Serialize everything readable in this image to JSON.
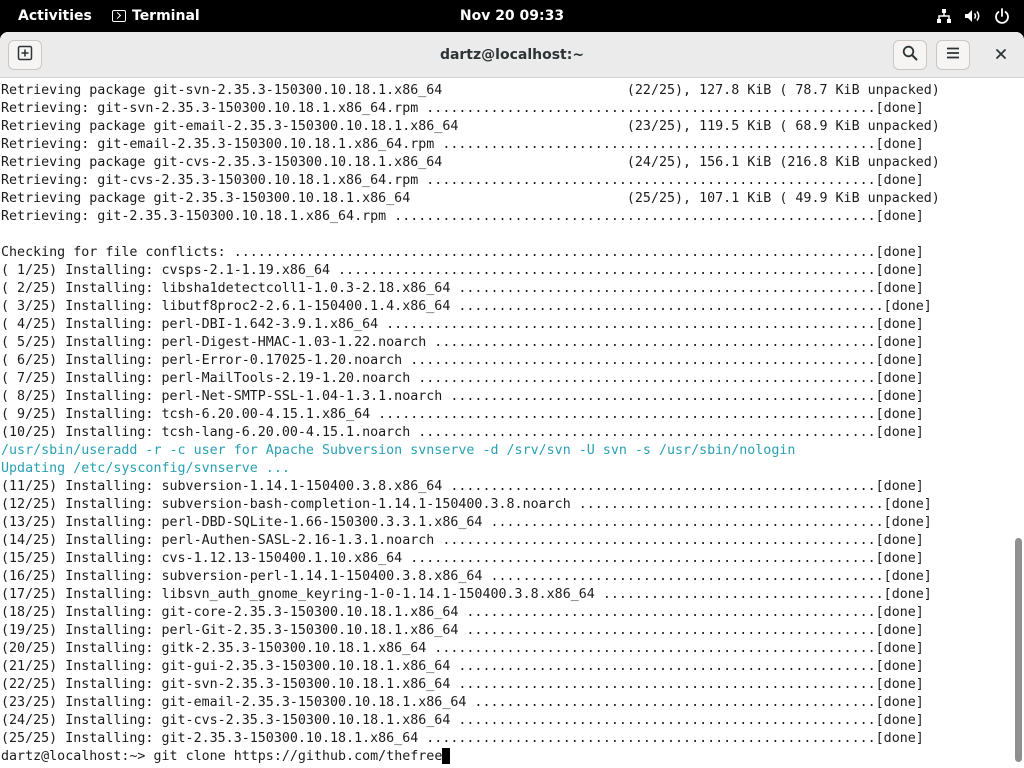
{
  "topbar": {
    "activities": "Activities",
    "app_name": "Terminal",
    "clock": "Nov 20  09:33",
    "icons": [
      "network-icon",
      "volume-icon",
      "power-icon"
    ]
  },
  "window": {
    "title": "dartz@localhost:~",
    "buttons": [
      "new-tab-icon",
      "search-icon",
      "hamburger-menu-icon",
      "close-icon"
    ]
  },
  "colors": {
    "terminal_text": "#1c1c1c",
    "cyan_text": "#2aa1b3",
    "terminal_bg": "#ffffff",
    "topbar_bg": "#000000"
  },
  "terminal": {
    "lines": [
      {
        "text": "Retrieving package git-svn-2.35.3-150300.10.18.1.x86_64                       (22/25), 127.8 KiB ( 78.7 KiB unpacked)",
        "color": "default"
      },
      {
        "text": "Retrieving: git-svn-2.35.3-150300.10.18.1.x86_64.rpm ........................................................[done]",
        "color": "default"
      },
      {
        "text": "Retrieving package git-email-2.35.3-150300.10.18.1.x86_64                     (23/25), 119.5 KiB ( 68.9 KiB unpacked)",
        "color": "default"
      },
      {
        "text": "Retrieving: git-email-2.35.3-150300.10.18.1.x86_64.rpm ......................................................[done]",
        "color": "default"
      },
      {
        "text": "Retrieving package git-cvs-2.35.3-150300.10.18.1.x86_64                       (24/25), 156.1 KiB (216.8 KiB unpacked)",
        "color": "default"
      },
      {
        "text": "Retrieving: git-cvs-2.35.3-150300.10.18.1.x86_64.rpm ........................................................[done]",
        "color": "default"
      },
      {
        "text": "Retrieving package git-2.35.3-150300.10.18.1.x86_64                           (25/25), 107.1 KiB ( 49.9 KiB unpacked)",
        "color": "default"
      },
      {
        "text": "Retrieving: git-2.35.3-150300.10.18.1.x86_64.rpm ............................................................[done]",
        "color": "default"
      },
      {
        "text": "",
        "color": "default"
      },
      {
        "text": "Checking for file conflicts: ................................................................................[done]",
        "color": "default"
      },
      {
        "text": "( 1/25) Installing: cvsps-2.1-1.19.x86_64 ...................................................................[done]",
        "color": "default"
      },
      {
        "text": "( 2/25) Installing: libsha1detectcoll1-1.0.3-2.18.x86_64 ....................................................[done]",
        "color": "default"
      },
      {
        "text": "( 3/25) Installing: libutf8proc2-2.6.1-150400.1.4.x86_64 .....................................................[done]",
        "color": "default"
      },
      {
        "text": "( 4/25) Installing: perl-DBI-1.642-3.9.1.x86_64 .............................................................[done]",
        "color": "default"
      },
      {
        "text": "( 5/25) Installing: perl-Digest-HMAC-1.03-1.22.noarch .......................................................[done]",
        "color": "default"
      },
      {
        "text": "( 6/25) Installing: perl-Error-0.17025-1.20.noarch ..........................................................[done]",
        "color": "default"
      },
      {
        "text": "( 7/25) Installing: perl-MailTools-2.19-1.20.noarch .........................................................[done]",
        "color": "default"
      },
      {
        "text": "( 8/25) Installing: perl-Net-SMTP-SSL-1.04-1.3.1.noarch .....................................................[done]",
        "color": "default"
      },
      {
        "text": "( 9/25) Installing: tcsh-6.20.00-4.15.1.x86_64 ..............................................................[done]",
        "color": "default"
      },
      {
        "text": "(10/25) Installing: tcsh-lang-6.20.00-4.15.1.noarch .........................................................[done]",
        "color": "default"
      },
      {
        "text": "/usr/sbin/useradd -r -c user for Apache Subversion svnserve -d /srv/svn -U svn -s /usr/sbin/nologin",
        "color": "cyan"
      },
      {
        "text": "Updating /etc/sysconfig/svnserve ...",
        "color": "cyan"
      },
      {
        "text": "(11/25) Installing: subversion-1.14.1-150400.3.8.x86_64 .....................................................[done]",
        "color": "default"
      },
      {
        "text": "(12/25) Installing: subversion-bash-completion-1.14.1-150400.3.8.noarch ......................................[done]",
        "color": "default"
      },
      {
        "text": "(13/25) Installing: perl-DBD-SQLite-1.66-150300.3.3.1.x86_64 .................................................[done]",
        "color": "default"
      },
      {
        "text": "(14/25) Installing: perl-Authen-SASL-2.16-1.3.1.noarch ......................................................[done]",
        "color": "default"
      },
      {
        "text": "(15/25) Installing: cvs-1.12.13-150400.1.10.x86_64 ..........................................................[done]",
        "color": "default"
      },
      {
        "text": "(16/25) Installing: subversion-perl-1.14.1-150400.3.8.x86_64 .................................................[done]",
        "color": "default"
      },
      {
        "text": "(17/25) Installing: libsvn_auth_gnome_keyring-1-0-1.14.1-150400.3.8.x86_64 ...................................[done]",
        "color": "default"
      },
      {
        "text": "(18/25) Installing: git-core-2.35.3-150300.10.18.1.x86_64 ...................................................[done]",
        "color": "default"
      },
      {
        "text": "(19/25) Installing: perl-Git-2.35.3-150300.10.18.1.x86_64 ...................................................[done]",
        "color": "default"
      },
      {
        "text": "(20/25) Installing: gitk-2.35.3-150300.10.18.1.x86_64 .......................................................[done]",
        "color": "default"
      },
      {
        "text": "(21/25) Installing: git-gui-2.35.3-150300.10.18.1.x86_64 ....................................................[done]",
        "color": "default"
      },
      {
        "text": "(22/25) Installing: git-svn-2.35.3-150300.10.18.1.x86_64 ....................................................[done]",
        "color": "default"
      },
      {
        "text": "(23/25) Installing: git-email-2.35.3-150300.10.18.1.x86_64 ..................................................[done]",
        "color": "default"
      },
      {
        "text": "(24/25) Installing: git-cvs-2.35.3-150300.10.18.1.x86_64 ....................................................[done]",
        "color": "default"
      },
      {
        "text": "(25/25) Installing: git-2.35.3-150300.10.18.1.x86_64 ........................................................[done]",
        "color": "default"
      }
    ],
    "prompt": "dartz@localhost:~> ",
    "command": "git clone https://github.com/thefree"
  }
}
